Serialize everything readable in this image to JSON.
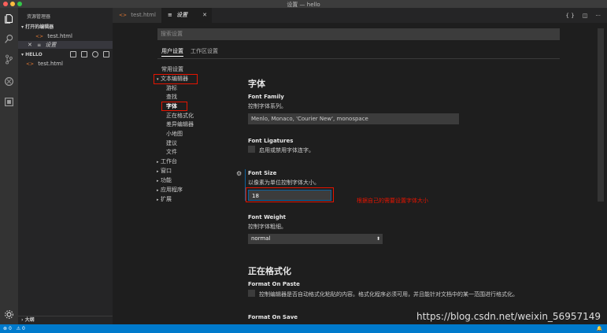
{
  "window": {
    "title": "设置 — hello"
  },
  "sidebar": {
    "title": "资源管理器",
    "open_editors": {
      "header": "打开的编辑器",
      "items": [
        {
          "label": "test.html",
          "icon": "html-file-icon"
        },
        {
          "label": "设置",
          "icon": "settings-file-icon"
        }
      ]
    },
    "folder": {
      "header": "HELLO",
      "items": [
        {
          "label": "test.html",
          "icon": "html-file-icon"
        }
      ]
    },
    "outline_header": "大纲"
  },
  "tabs": [
    {
      "label": "test.html",
      "active": false
    },
    {
      "label": "设置",
      "active": true
    }
  ],
  "settings": {
    "search_placeholder": "搜索设置",
    "scope_tabs": [
      "用户设置",
      "工作区设置"
    ],
    "toc": {
      "common": "常用设置",
      "text_editor": "文本编辑器",
      "text_editor_children": [
        "游标",
        "查找",
        "字体",
        "正在格式化",
        "差异编辑器",
        "小地图",
        "建议",
        "文件"
      ],
      "others": [
        "工作台",
        "窗口",
        "功能",
        "应用程序",
        "扩展"
      ]
    },
    "section_font": "字体",
    "font_family": {
      "name": "Font Family",
      "desc": "控制字体系列。",
      "value": "Menlo, Monaco, 'Courier New', monospace"
    },
    "font_ligatures": {
      "name": "Font Ligatures",
      "desc": "启用或禁用字体连字。"
    },
    "font_size": {
      "name": "Font Size",
      "desc": "以像素为单位控制字体大小。",
      "value": "18"
    },
    "annotation": "根据自己的需要设置字体大小",
    "font_weight": {
      "name": "Font Weight",
      "desc": "控制字体粗细。",
      "value": "normal"
    },
    "section_formatting": "正在格式化",
    "format_on_paste": {
      "name": "Format On Paste",
      "desc": "控制编辑器是否自动格式化粘贴的内容。格式化程序必须可用，并且能针对文档中的某一范围进行格式化。"
    },
    "format_on_save": {
      "name": "Format On Save"
    }
  },
  "statusbar": {
    "errors": "0",
    "warnings": "0"
  },
  "watermark": "https://blog.csdn.net/weixin_56957149",
  "colors": {
    "accent": "#007acc",
    "highlight_box": "#e51400",
    "annotation": "#e51400"
  }
}
